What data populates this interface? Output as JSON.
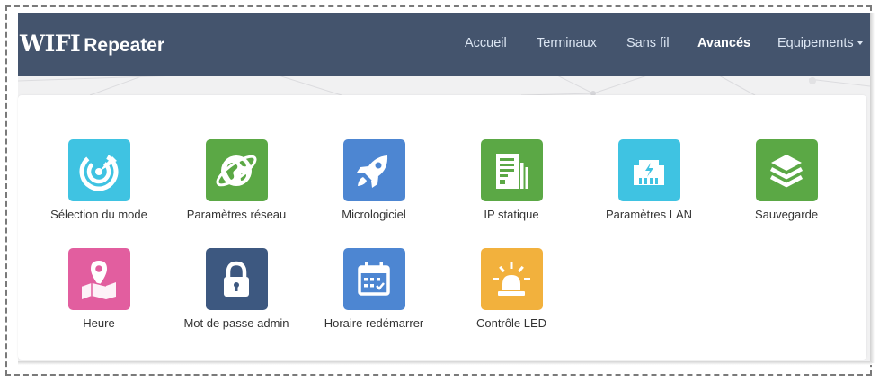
{
  "brand": {
    "part1": "WIFI",
    "part2": "Repeater"
  },
  "nav": [
    {
      "label": "Accueil",
      "active": false
    },
    {
      "label": "Terminaux",
      "active": false
    },
    {
      "label": "Sans fil",
      "active": false
    },
    {
      "label": "Avancés",
      "active": true
    },
    {
      "label": "Equipements",
      "active": false,
      "dropdown": true
    }
  ],
  "tiles": [
    {
      "label": "Sélection du mode",
      "icon": "radar-icon",
      "color": "#3fc3e2"
    },
    {
      "label": "Paramètres réseau",
      "icon": "globe-icon",
      "color": "#5ba845"
    },
    {
      "label": "Micrologiciel",
      "icon": "rocket-icon",
      "color": "#4d86d2"
    },
    {
      "label": "IP statique",
      "icon": "document-icon",
      "color": "#5ba845"
    },
    {
      "label": "Paramètres LAN",
      "icon": "ethernet-port-icon",
      "color": "#3fc3e2"
    },
    {
      "label": "Sauvegarde",
      "icon": "layers-icon",
      "color": "#5ba845"
    },
    {
      "label": "Heure",
      "icon": "map-pin-icon",
      "color": "#e25e9f"
    },
    {
      "label": "Mot de passe admin",
      "icon": "lock-icon",
      "color": "#3d5880"
    },
    {
      "label": "Horaire redémarrer",
      "icon": "calendar-icon",
      "color": "#4d86d2"
    },
    {
      "label": "Contrôle LED",
      "icon": "siren-light-icon",
      "color": "#f2b13d"
    }
  ]
}
